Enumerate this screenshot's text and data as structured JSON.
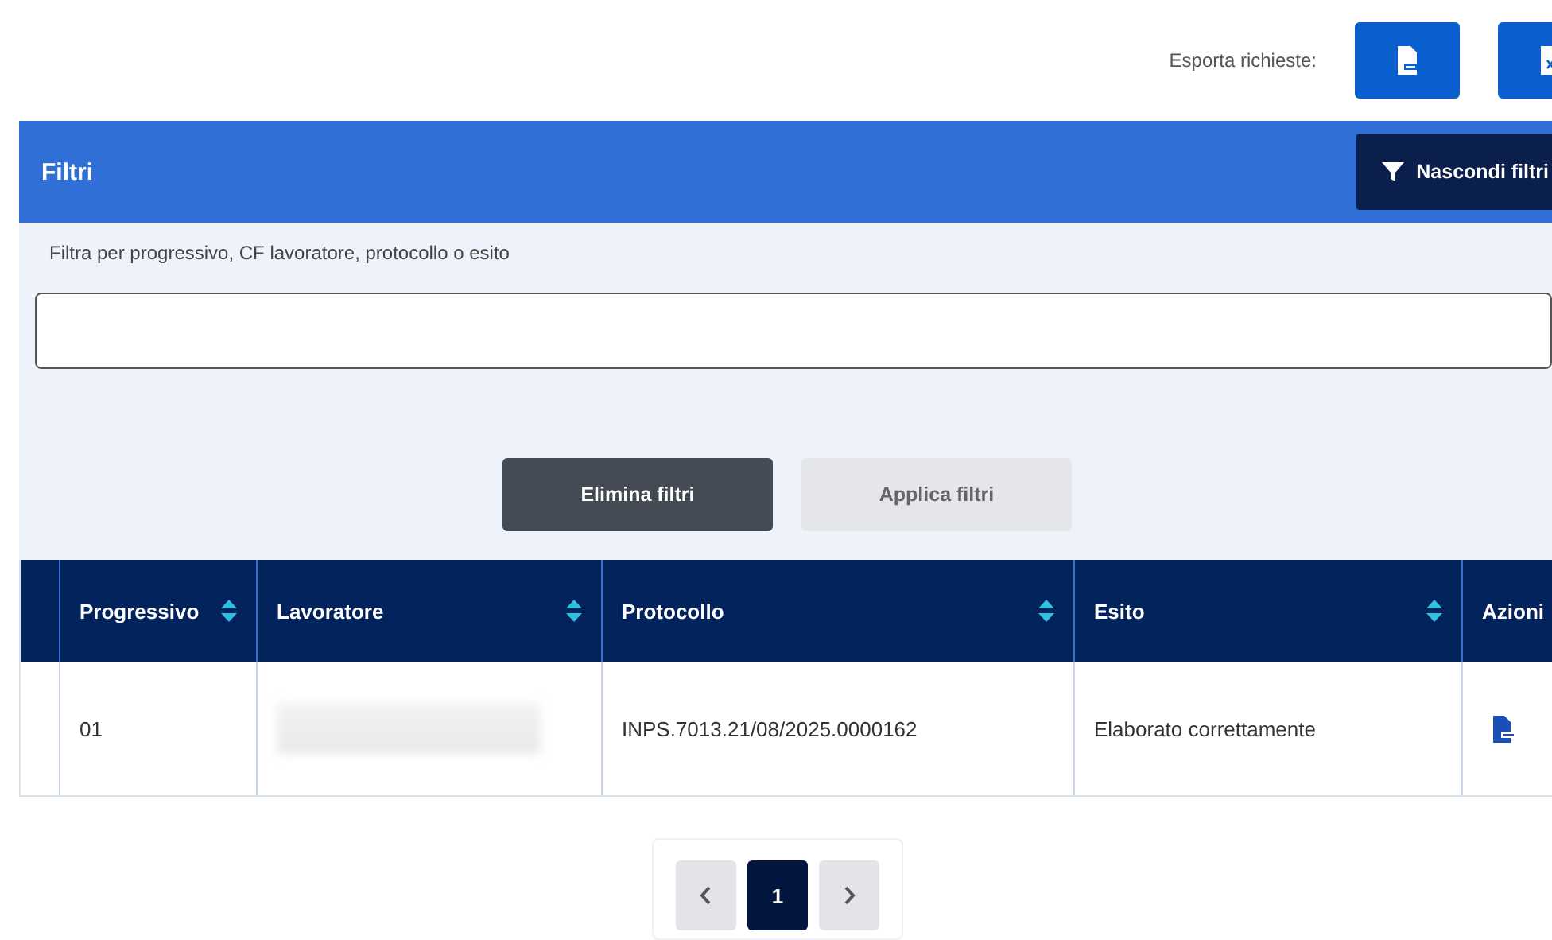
{
  "export": {
    "label": "Esporta richieste:",
    "buttons": [
      {
        "kind": "pdf"
      },
      {
        "kind": "xls"
      }
    ]
  },
  "filters": {
    "title": "Filtri",
    "toggle_button": "Nascondi filtri",
    "field_label": "Filtra per progressivo, CF lavoratore, protocollo o esito",
    "buttons": [
      {
        "label": "Elimina filtri",
        "disabled": false
      },
      {
        "label": "Applica filtri",
        "disabled": true
      }
    ]
  },
  "table": {
    "columns": [
      {
        "label": "Progressivo",
        "sortable": true
      },
      {
        "label": "Lavoratore",
        "sortable": true
      },
      {
        "label": "Protocollo",
        "sortable": true
      },
      {
        "label": "Esito",
        "sortable": true
      },
      {
        "label": "Azioni",
        "sortable": false
      }
    ],
    "rows": [
      {
        "progressivo": "01",
        "lavoratore_redacted": true,
        "protocollo": "INPS.7013.21/08/2025.0000162",
        "esito": "Elaborato correttamente"
      }
    ]
  },
  "pagination": {
    "pages": [
      {
        "label": "1",
        "selected": true
      }
    ]
  }
}
